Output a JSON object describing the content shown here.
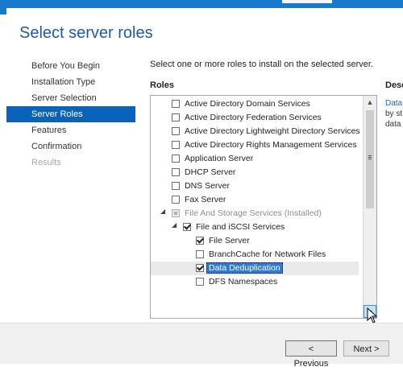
{
  "window": {
    "title": "Select server roles"
  },
  "nav": {
    "items": [
      {
        "label": "Before You Begin",
        "state": "normal"
      },
      {
        "label": "Installation Type",
        "state": "normal"
      },
      {
        "label": "Server Selection",
        "state": "normal"
      },
      {
        "label": "Server Roles",
        "state": "active"
      },
      {
        "label": "Features",
        "state": "normal"
      },
      {
        "label": "Confirmation",
        "state": "normal"
      },
      {
        "label": "Results",
        "state": "disabled"
      }
    ]
  },
  "main": {
    "instruction": "Select one or more roles to install on the selected server.",
    "roles_heading": "Roles",
    "description_heading": "Desc",
    "description_lines": [
      "Data",
      "by st",
      "data"
    ]
  },
  "roles": [
    {
      "label": "Active Directory Domain Services",
      "checked": false,
      "level": 0
    },
    {
      "label": "Active Directory Federation Services",
      "checked": false,
      "level": 0
    },
    {
      "label": "Active Directory Lightweight Directory Services",
      "checked": false,
      "level": 0
    },
    {
      "label": "Active Directory Rights Management Services",
      "checked": false,
      "level": 0
    },
    {
      "label": "Application Server",
      "checked": false,
      "level": 0
    },
    {
      "label": "DHCP Server",
      "checked": false,
      "level": 0
    },
    {
      "label": "DNS Server",
      "checked": false,
      "level": 0
    },
    {
      "label": "Fax Server",
      "checked": false,
      "level": 0
    },
    {
      "label": "File And Storage Services (Installed)",
      "checked": "partial",
      "level": 0,
      "expanded": true,
      "grayed": true
    },
    {
      "label": "File and iSCSI Services",
      "checked": true,
      "level": 1,
      "expanded": true
    },
    {
      "label": "File Server",
      "checked": true,
      "level": 2
    },
    {
      "label": "BranchCache for Network Files",
      "checked": false,
      "level": 2
    },
    {
      "label": "Data Deduplication",
      "checked": true,
      "level": 2,
      "selected": true
    },
    {
      "label": "DFS Namespaces",
      "checked": false,
      "level": 2
    }
  ],
  "footer": {
    "previous_label": "< Previous",
    "next_label": "Next >"
  },
  "colors": {
    "accent": "#0a63b9",
    "title": "#1f5aa6",
    "selection": "#2f7ad4"
  }
}
